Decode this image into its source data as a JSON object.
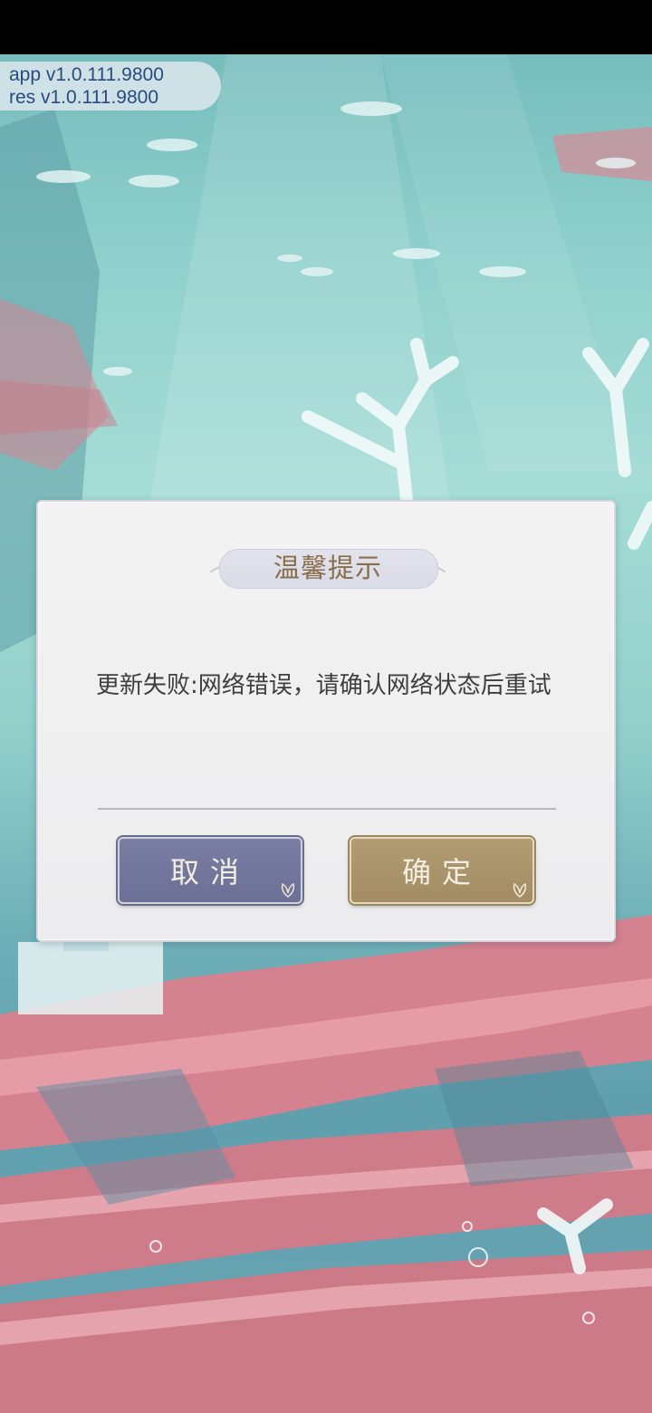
{
  "version": {
    "app": "app v1.0.111.9800",
    "res": "res v1.0.111.9800"
  },
  "dialog": {
    "title": "温馨提示",
    "message": "更新失败:网络错误，请确认网络状态后重试",
    "cancel_label": "取消",
    "confirm_label": "确定"
  },
  "colors": {
    "cancel_button": "#6c7096",
    "confirm_button": "#a38c63",
    "title_text": "#8a6e4c",
    "version_text": "#2a4a80"
  },
  "icons": [
    "fish-icon",
    "coral-icon",
    "butterfly-icon"
  ]
}
